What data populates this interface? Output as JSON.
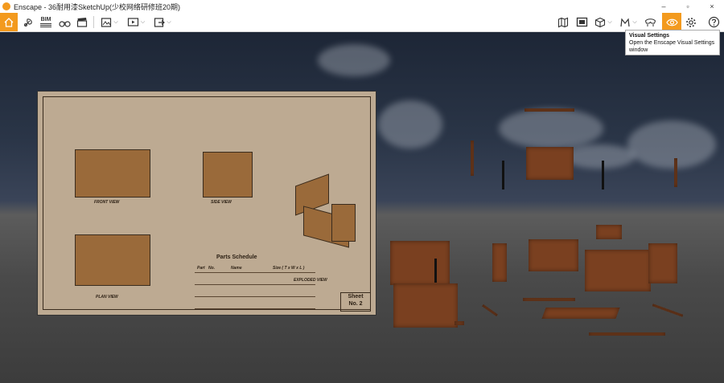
{
  "window": {
    "title": "Enscape - 36耐用漆SketchUp(少校网络研修班20期)",
    "minimize": "–",
    "maximize": "▫",
    "close": "×"
  },
  "toolbar": {
    "bim_label": "BIM",
    "left_tools": [
      {
        "name": "home-icon",
        "active": true
      },
      {
        "name": "asset-library-icon"
      },
      {
        "name": "bim-icon"
      },
      {
        "name": "binoculars-icon"
      },
      {
        "name": "clapperboard-icon"
      },
      {
        "name": "screenshot-icon"
      },
      {
        "name": "video-icon"
      },
      {
        "name": "export-icon"
      }
    ],
    "right_tools": [
      {
        "name": "map-icon"
      },
      {
        "name": "gallery-icon"
      },
      {
        "name": "cube-icon"
      },
      {
        "name": "views-icon"
      },
      {
        "name": "vr-headset-icon"
      },
      {
        "name": "visual-settings-icon",
        "active": true
      },
      {
        "name": "gear-icon"
      },
      {
        "name": "help-icon"
      }
    ],
    "caret": "⌵"
  },
  "tooltip": {
    "title": "Visual Settings",
    "body": "Open the Enscape Visual Settings window"
  },
  "sheet": {
    "front_view": "FRONT VIEW",
    "side_view": "SIDE VIEW",
    "plan_view": "PLAN VIEW",
    "exploded_view": "EXPLODED VIEW",
    "parts_schedule": "Parts Schedule",
    "sheet_label": "Sheet",
    "sheet_number": "No. 2",
    "table_headers": [
      "Part",
      "No.",
      "Name",
      "Size ( T x W x L )"
    ]
  },
  "colors": {
    "accent": "#f39a1e",
    "wood": "#7a4020",
    "paper": "#bdaa92"
  }
}
